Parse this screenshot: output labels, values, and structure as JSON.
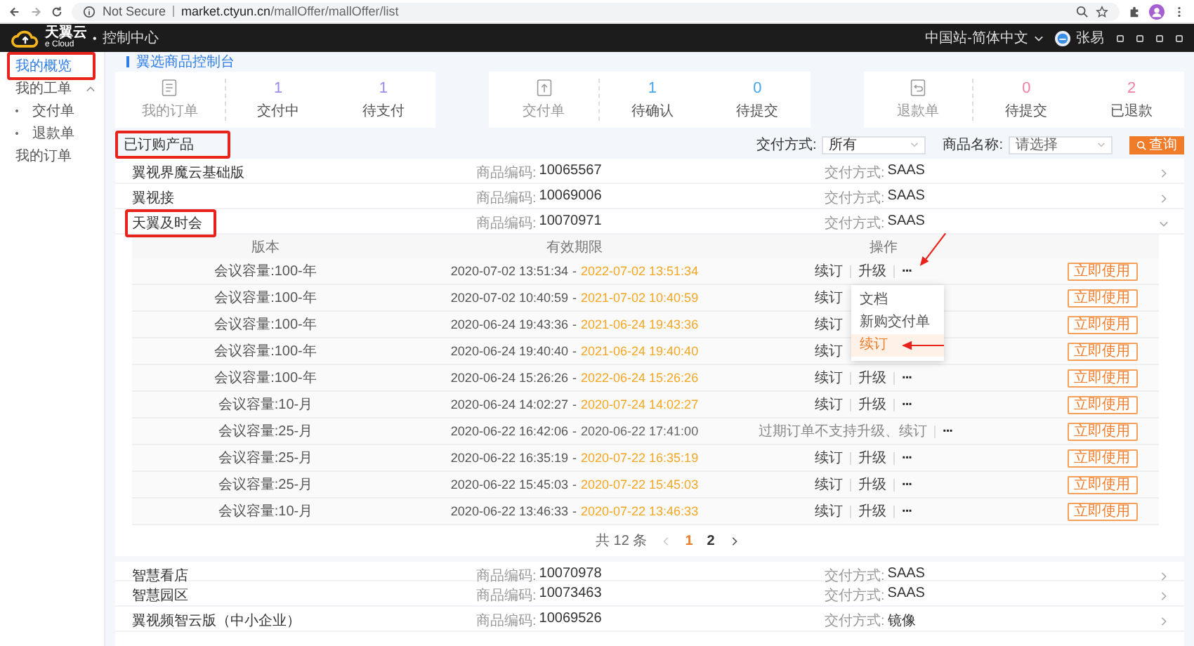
{
  "browser": {
    "security": "Not Secure",
    "url_host": "market.ctyun.cn",
    "url_path": "/mallOffer/mallOffer/list"
  },
  "header": {
    "logo_text": "天翼云",
    "logo_sub": "e Cloud",
    "dot": "•",
    "title": "控制中心",
    "locale": "中国站-简体中文",
    "user": "张易"
  },
  "sidebar": {
    "items": [
      {
        "label": "我的概览",
        "selected": true,
        "annotated": true
      },
      {
        "label": "我的工单",
        "selected": false,
        "expanded": true,
        "children": [
          {
            "label": "交付单",
            "selected": false
          },
          {
            "label": "退款单",
            "selected": false
          }
        ]
      },
      {
        "label": "我的订单",
        "selected": false
      }
    ]
  },
  "breadcrumb": "翼选商品控制台",
  "stat_cards": [
    {
      "label": "我的订单",
      "kind": "document",
      "color": "#9b8cf0",
      "stats": [
        {
          "value": "1",
          "label": "交付中"
        },
        {
          "value": "1",
          "label": "待支付"
        }
      ]
    },
    {
      "label": "交付单",
      "kind": "upload",
      "color": "#46a6f0",
      "stats": [
        {
          "value": "1",
          "label": "待确认"
        },
        {
          "value": "0",
          "label": "待提交"
        }
      ]
    },
    {
      "label": "退款单",
      "kind": "return",
      "color": "#f27fa0",
      "stats": [
        {
          "value": "0",
          "label": "待提交"
        },
        {
          "value": "2",
          "label": "已退款"
        }
      ]
    }
  ],
  "section": {
    "title": "已订购产品",
    "annotated": true
  },
  "filters": {
    "delivery_label": "交付方式:",
    "delivery_value": "所有",
    "name_label": "商品名称:",
    "name_placeholder": "请选择",
    "search_button": "查询"
  },
  "products": [
    {
      "name": "翼视界魔云基础版",
      "code_label": "商品编码:",
      "code": "10065567",
      "delivery_label": "交付方式:",
      "delivery": "SAAS",
      "expanded": false,
      "annotated": false
    },
    {
      "name": "翼视接",
      "code_label": "商品编码:",
      "code": "10069006",
      "delivery_label": "交付方式:",
      "delivery": "SAAS",
      "expanded": false,
      "annotated": false
    },
    {
      "name": "天翼及时会",
      "code_label": "商品编码:",
      "code": "10070971",
      "delivery_label": "交付方式:",
      "delivery": "SAAS",
      "expanded": true,
      "annotated": true,
      "table": {
        "columns": [
          "版本",
          "有效期限",
          "操作"
        ],
        "range_separator": "-",
        "rows": [
          {
            "version": "会议容量:100-年",
            "start": "2020-07-02 13:51:34",
            "end": "2022-07-02 13:51:34",
            "expired": false,
            "actions": [
              "续订",
              "升级"
            ],
            "more": "···",
            "more_annotated": true,
            "menu": [
              {
                "label": "文档",
                "selected": false,
                "annotated": false
              },
              {
                "label": "新购交付单",
                "selected": false,
                "annotated": false
              },
              {
                "label": "续订",
                "selected": true,
                "annotated": true
              }
            ],
            "use": "立即使用"
          },
          {
            "version": "会议容量:100-年",
            "start": "2020-07-02 10:40:59",
            "end": "2021-07-02 10:40:59",
            "expired": false,
            "actions": [
              "续订"
            ],
            "use": "立即使用"
          },
          {
            "version": "会议容量:100-年",
            "start": "2020-06-24 19:43:36",
            "end": "2021-06-24 19:43:36",
            "expired": false,
            "actions": [
              "续订"
            ],
            "use": "立即使用"
          },
          {
            "version": "会议容量:100-年",
            "start": "2020-06-24 19:40:40",
            "end": "2021-06-24 19:40:40",
            "expired": false,
            "actions": [
              "续订"
            ],
            "use": "立即使用"
          },
          {
            "version": "会议容量:100-年",
            "start": "2020-06-24 15:26:26",
            "end": "2022-06-24 15:26:26",
            "expired": false,
            "actions": [
              "续订",
              "升级"
            ],
            "more": "···",
            "use": "立即使用"
          },
          {
            "version": "会议容量:10-月",
            "start": "2020-06-24 14:02:27",
            "end": "2020-07-24 14:02:27",
            "expired": false,
            "actions": [
              "续订",
              "升级"
            ],
            "more": "···",
            "use": "立即使用"
          },
          {
            "version": "会议容量:25-月",
            "start": "2020-06-22 16:42:06",
            "end": "2020-06-22 17:41:00",
            "expired": true,
            "note": "过期订单不支持升级、续订",
            "more": "···",
            "use": "立即使用"
          },
          {
            "version": "会议容量:25-月",
            "start": "2020-06-22 16:35:19",
            "end": "2020-07-22 16:35:19",
            "expired": false,
            "actions": [
              "续订",
              "升级"
            ],
            "more": "···",
            "use": "立即使用"
          },
          {
            "version": "会议容量:25-月",
            "start": "2020-06-22 15:45:03",
            "end": "2020-07-22 15:45:03",
            "expired": false,
            "actions": [
              "续订",
              "升级"
            ],
            "more": "···",
            "use": "立即使用"
          },
          {
            "version": "会议容量:10-月",
            "start": "2020-06-22 13:46:33",
            "end": "2020-07-22 13:46:33",
            "expired": false,
            "actions": [
              "续订",
              "升级"
            ],
            "more": "···",
            "use": "立即使用"
          }
        ],
        "pagination": {
          "total": "共 12 条",
          "pages": [
            {
              "label": "1",
              "selected": true
            },
            {
              "label": "2",
              "selected": false
            }
          ]
        }
      }
    },
    {
      "name": "智慧看店",
      "code_label": "商品编码:",
      "code": "10070978",
      "delivery_label": "交付方式:",
      "delivery": "SAAS",
      "expanded": false,
      "annotated": false
    },
    {
      "name": "智慧园区",
      "code_label": "商品编码:",
      "code": "10073463",
      "delivery_label": "交付方式:",
      "delivery": "SAAS",
      "expanded": false,
      "annotated": false
    },
    {
      "name": "翼视频智云版（中小企业）",
      "code_label": "商品编码:",
      "code": "10069526",
      "delivery_label": "交付方式:",
      "delivery": "镜像",
      "expanded": false,
      "annotated": false
    }
  ]
}
